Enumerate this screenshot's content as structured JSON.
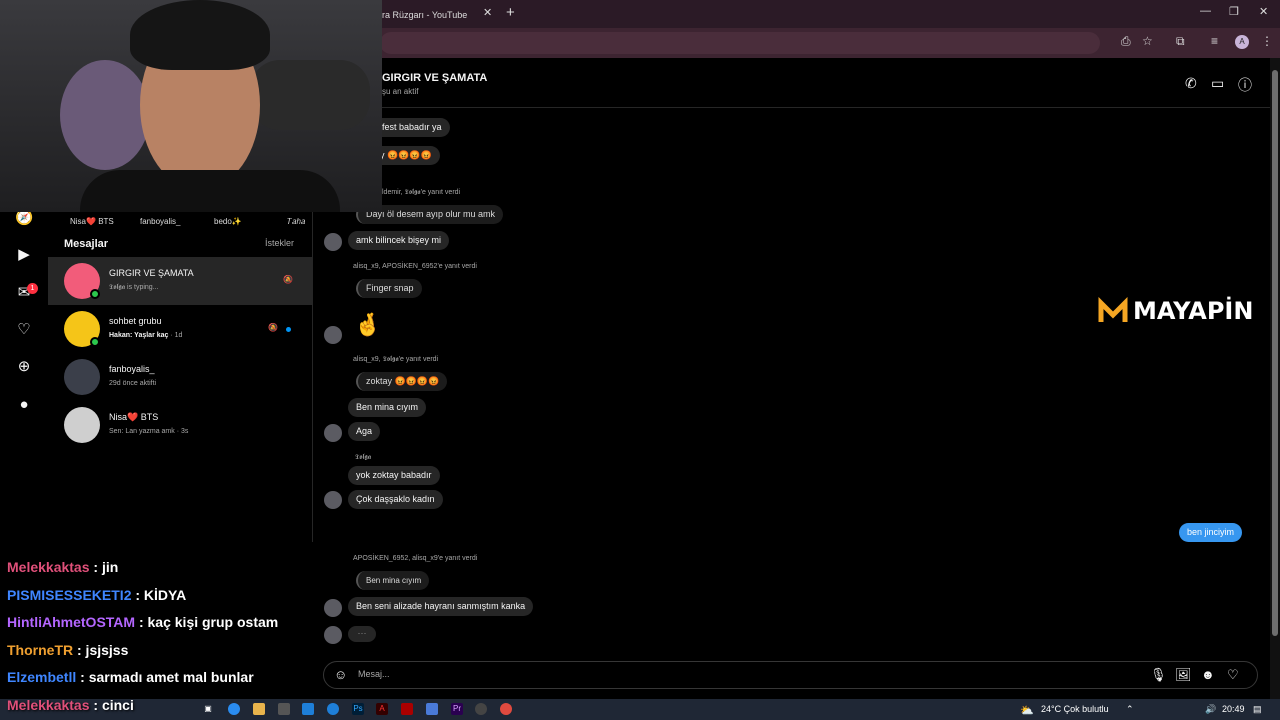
{
  "browser": {
    "tab_title": "ra Rüzgarı - YouTube",
    "tab_close": "✕",
    "new_tab": "+",
    "profile_initial": "A",
    "controls": {
      "minimize": "—",
      "maximize": "❐",
      "close": "✕"
    }
  },
  "stories": [
    "Nisa❤️ BTS",
    "fanboyalis_",
    "bedo✨",
    "𝑇𝑎ℎ𝑎"
  ],
  "inbox": {
    "title": "Mesajlar",
    "requests_label": "İstekler",
    "conversations": [
      {
        "name": "GIRGIR VE ŞAMATA",
        "subtitle": "𝕿𝖔𝖑𝖌𝖆 is typing...",
        "muted_icon": "bell-off-icon"
      },
      {
        "name": "sohbet grubu",
        "subtitle_bold": "Hakan: Yaşlar kaç",
        "subtitle_time": "· 1d",
        "muted_icon": "bell-off-icon"
      },
      {
        "name": "fanboyalis_",
        "subtitle": "29d önce aktifti"
      },
      {
        "name": "Nisa❤️ BTS",
        "subtitle": "Sen: Lan yazma amk · 3s"
      }
    ]
  },
  "chat": {
    "title": "GIRGIR VE ŞAMATA",
    "status": "şu an aktif",
    "messages": {
      "m1": "ifest babadır ya",
      "m2": "y 😡😡😡😡",
      "reply_meta_1": "ldemir, 𝕿𝖔𝖑𝖌𝖆'e yanıt verdi",
      "reply_1": "Dayı öl desem ayıp olur mu amk",
      "m3": "amk bilincek bişey mi",
      "reply_meta_2": "alisq_x9, APOSİKEN_6952'e yanıt verdi",
      "reply_2": "Finger snap",
      "emoji_big": "🤞",
      "reply_meta_3": "alisq_x9, 𝕿𝖔𝖑𝖌𝖆'e yanıt verdi",
      "reply_3": "zoktay 😡😡😡😡",
      "m4": "Ben mina cıyım",
      "m5": "Aga",
      "sender_tolga": "𝕿𝖔𝖑𝖌𝖆",
      "m6": "yok zoktay babadır",
      "m7": "Çok daşşaklo kadın",
      "mine_1": "ben jinciyim",
      "reply_meta_4": "APOSİKEN_6952, alisq_x9'e yanıt verdi",
      "reply_4": "Ben mina cıyım",
      "m8": "Ben seni alizade hayranı sanmıştım kanka",
      "typing": "···"
    },
    "composer_placeholder": "Mesaj..."
  },
  "watermark": "MAYAPİN",
  "stream_chat": [
    {
      "user": "Melekkaktas",
      "msg": " : jin",
      "color": "#e0507a"
    },
    {
      "user": "PISMISESSEKETI2",
      "msg": " : KİDYA",
      "color": "#3f86ff"
    },
    {
      "user": "HintliAhmetOSTAM",
      "msg": " : kaç kişi grup ostam",
      "color": "#b466ff"
    },
    {
      "user": "ThorneTR",
      "msg": " : jsjsjss",
      "color": "#f0a030"
    },
    {
      "user": "Elzembetll",
      "msg": " : sarmadı amet mal bunlar",
      "color": "#3f86ff"
    },
    {
      "user": "Melekkaktas",
      "msg": " : cinci",
      "color": "#e0507a"
    }
  ],
  "taskbar": {
    "weather": "24°C  Çok bulutlu",
    "time": "20:49"
  },
  "colors": {
    "accent": "#3797f0",
    "online": "#2cc84d",
    "badge": "#ff3040"
  }
}
